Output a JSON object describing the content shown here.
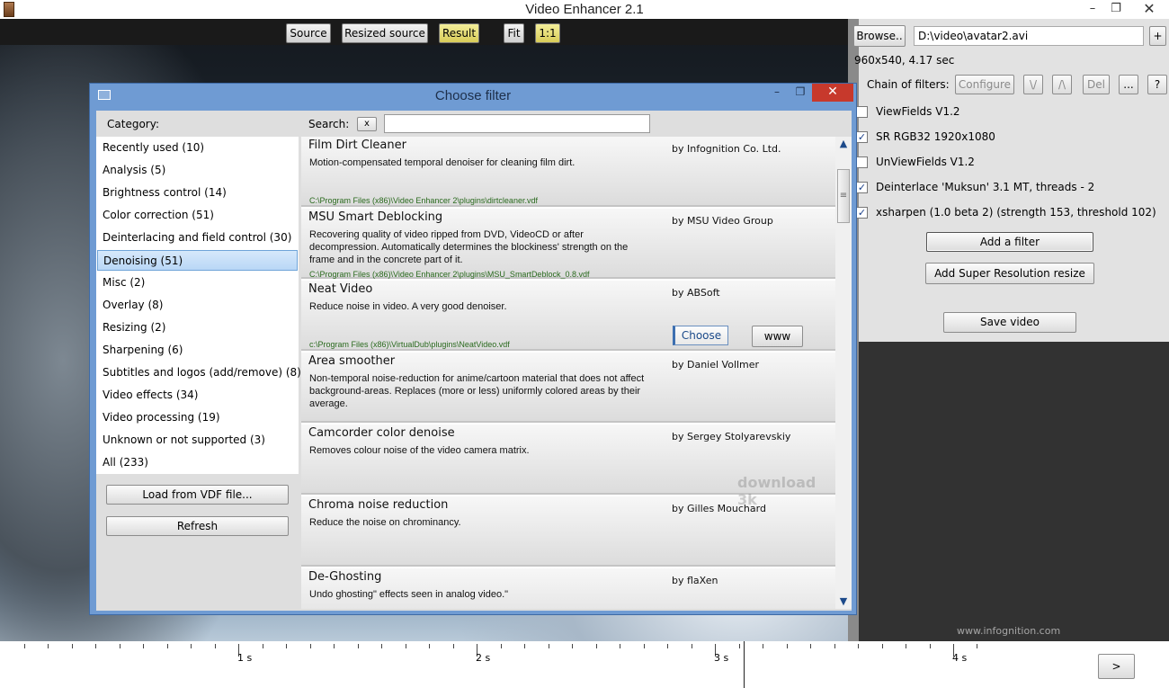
{
  "window": {
    "title": "Video Enhancer 2.1",
    "minimize": "–",
    "maximize": "❐",
    "close": "✕"
  },
  "video_toolbar": {
    "source": "Source",
    "resized_source": "Resized source",
    "result": "Result",
    "fit": "Fit",
    "one_to_one": "1:1"
  },
  "right_panel": {
    "browse": "Browse..",
    "file_path": "D:\\video\\avatar2.avi",
    "plus": "+",
    "video_info": "960x540, 4.17 sec",
    "chain_label": "Chain of filters:",
    "configure": "Configure",
    "move_down": "\\/",
    "move_up": "/\\",
    "delete": "Del",
    "more": "...",
    "help": "?",
    "chain": [
      {
        "label": "ViewFields V1.2",
        "checked": false
      },
      {
        "label": "SR RGB32 1920x1080",
        "checked": true
      },
      {
        "label": "UnViewFields V1.2",
        "checked": false
      },
      {
        "label": "Deinterlace 'Muksun' 3.1 MT, threads - 2",
        "checked": true
      },
      {
        "label": "xsharpen (1.0 beta 2) (strength 153, threshold 102)",
        "checked": true
      }
    ],
    "add_filter": "Add a filter",
    "add_sr": "Add Super Resolution resize",
    "save_video": "Save video",
    "credit": "www.infognition.com"
  },
  "timeline": {
    "labels": [
      "1 s",
      "2 s",
      "3 s",
      "4 s"
    ],
    "next": ">"
  },
  "dialog": {
    "title": "Choose filter",
    "category_label": "Category:",
    "search_label": "Search:",
    "search_clear": "x",
    "search_value": "",
    "categories": [
      "Recently used (10)",
      "Analysis (5)",
      "Brightness control (14)",
      "Color correction (51)",
      "Deinterlacing and field control (30)",
      "Denoising (51)",
      "Misc (2)",
      "Overlay (8)",
      "Resizing (2)",
      "Sharpening (6)",
      "Subtitles and logos (add/remove) (8)",
      "Video effects (34)",
      "Video processing (19)",
      "Unknown or not supported (3)",
      "All (233)"
    ],
    "selected_category": "Denoising (51)",
    "load_vdf": "Load from VDF file...",
    "refresh": "Refresh",
    "filters": [
      {
        "name": "Film Dirt Cleaner",
        "author": "by Infognition Co. Ltd.",
        "desc": "Motion-compensated temporal denoiser for cleaning film dirt.",
        "path": "C:\\Program Files (x86)\\Video Enhancer 2\\plugins\\dirtcleaner.vdf"
      },
      {
        "name": "MSU Smart Deblocking",
        "author": "by MSU Video Group",
        "desc": "Recovering quality of video ripped from DVD, VideoCD or after decompression. Automatically determines the blockiness' strength on the frame and in the concrete part of it.",
        "path": "C:\\Program Files (x86)\\Video Enhancer 2\\plugins\\MSU_SmartDeblock_0.8.vdf"
      },
      {
        "name": "Neat Video",
        "author": "by ABSoft",
        "desc": "Reduce noise in video. A very good denoiser.",
        "path": "c:\\Program Files (x86)\\VirtualDub\\plugins\\NeatVideo.vdf",
        "choose": "Choose",
        "www": "www"
      },
      {
        "name": "Area smoother",
        "author": "by Daniel Vollmer",
        "desc": "Non-temporal noise-reduction for anime/cartoon material that does not affect background-areas. Replaces (more or less) uniformly colored areas by their average.",
        "path": ""
      },
      {
        "name": "Camcorder color denoise",
        "author": "by Sergey Stolyarevskiy",
        "desc": "Removes colour noise of the video camera matrix.",
        "path": ""
      },
      {
        "name": "Chroma noise reduction",
        "author": "by Gilles Mouchard",
        "desc": "Reduce the noise on chrominancy.",
        "path": ""
      },
      {
        "name": "De-Ghosting",
        "author": "by flaXen",
        "desc": "Undo ghosting\" effects seen in analog video.\"",
        "path": ""
      }
    ],
    "watermark": "download 3k"
  }
}
